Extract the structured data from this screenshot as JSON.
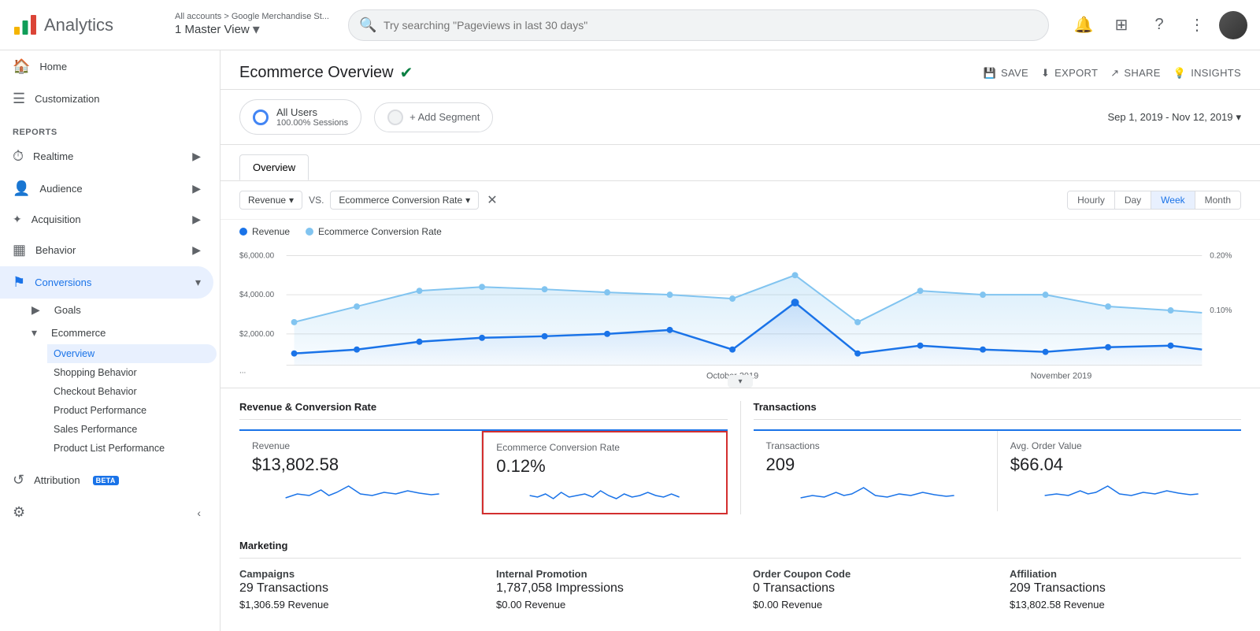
{
  "topNav": {
    "logoText": "Analytics",
    "breadcrumb": "All accounts > Google Merchandise St...",
    "viewLabel": "1 Master View",
    "searchPlaceholder": "Try searching \"Pageviews in last 30 days\"",
    "icons": [
      "bell",
      "grid",
      "help",
      "more-vert"
    ]
  },
  "sidebar": {
    "items": [
      {
        "id": "home",
        "label": "Home",
        "icon": "🏠",
        "level": 0
      },
      {
        "id": "customization",
        "label": "Customization",
        "icon": "☰",
        "level": 0
      },
      {
        "id": "reports-section",
        "label": "REPORTS",
        "type": "section"
      },
      {
        "id": "realtime",
        "label": "Realtime",
        "icon": "⏱",
        "level": 0,
        "expand": true
      },
      {
        "id": "audience",
        "label": "Audience",
        "icon": "👤",
        "level": 0,
        "expand": true
      },
      {
        "id": "acquisition",
        "label": "Acquisition",
        "icon": "✦",
        "level": 0,
        "expand": true
      },
      {
        "id": "behavior",
        "label": "Behavior",
        "icon": "▦",
        "level": 0,
        "expand": true
      },
      {
        "id": "conversions",
        "label": "Conversions",
        "icon": "⚑",
        "level": 0,
        "expand": true,
        "active": true
      },
      {
        "id": "goals",
        "label": "Goals",
        "level": 1,
        "expand": true
      },
      {
        "id": "ecommerce",
        "label": "Ecommerce",
        "level": 1,
        "expand": true
      },
      {
        "id": "overview",
        "label": "Overview",
        "level": 2,
        "active": true
      },
      {
        "id": "shopping-behavior",
        "label": "Shopping Behavior",
        "level": 2
      },
      {
        "id": "checkout-behavior",
        "label": "Checkout Behavior",
        "level": 2
      },
      {
        "id": "product-performance",
        "label": "Product Performance",
        "level": 2
      },
      {
        "id": "sales-performance",
        "label": "Sales Performance",
        "level": 2
      },
      {
        "id": "product-list-performance",
        "label": "Product List Performance",
        "level": 2
      },
      {
        "id": "attribution",
        "label": "Attribution",
        "icon": "↺",
        "level": 0,
        "badge": "BETA"
      }
    ]
  },
  "pageHeader": {
    "title": "Ecommerce Overview",
    "actions": [
      {
        "id": "save",
        "label": "SAVE",
        "icon": "💾"
      },
      {
        "id": "export",
        "label": "EXPORT",
        "icon": "⬇"
      },
      {
        "id": "share",
        "label": "SHARE",
        "icon": "↗"
      },
      {
        "id": "insights",
        "label": "INSIGHTS",
        "icon": "💡"
      }
    ]
  },
  "segment": {
    "allUsers": {
      "name": "All Users",
      "sub": "100.00% Sessions"
    },
    "addSegmentLabel": "+ Add Segment"
  },
  "dateRange": "Sep 1, 2019 - Nov 12, 2019",
  "tabs": [
    {
      "id": "overview",
      "label": "Overview",
      "active": true
    }
  ],
  "chartControls": {
    "metric1": "Revenue",
    "metric2": "Ecommerce Conversion Rate",
    "vsLabel": "VS.",
    "timeButtons": [
      {
        "id": "hourly",
        "label": "Hourly"
      },
      {
        "id": "day",
        "label": "Day"
      },
      {
        "id": "week",
        "label": "Week",
        "active": true
      },
      {
        "id": "month",
        "label": "Month"
      }
    ]
  },
  "chartLegend": {
    "items": [
      {
        "id": "revenue",
        "label": "Revenue",
        "color": "#1a73e8"
      },
      {
        "id": "ecr",
        "label": "Ecommerce Conversion Rate",
        "color": "#81c4f0"
      }
    ]
  },
  "chartYLabels": {
    "revenue": [
      "$6,000.00",
      "$4,000.00",
      "$2,000.00",
      "..."
    ],
    "ecr": [
      "0.20%",
      "0.10%"
    ]
  },
  "chartXLabels": [
    "October 2019",
    "November 2019"
  ],
  "metricsSection": {
    "title": "Revenue & Conversion Rate",
    "cards": [
      {
        "id": "revenue",
        "label": "Revenue",
        "value": "$13,802.58",
        "highlighted": false
      },
      {
        "id": "ecr",
        "label": "Ecommerce Conversion Rate",
        "value": "0.12%",
        "highlighted": true
      }
    ]
  },
  "transactionsSection": {
    "title": "Transactions",
    "cards": [
      {
        "id": "transactions",
        "label": "Transactions",
        "value": "209",
        "highlighted": false
      },
      {
        "id": "avg-order",
        "label": "Avg. Order Value",
        "value": "$66.04",
        "highlighted": false
      }
    ]
  },
  "marketingSection": {
    "title": "Marketing",
    "cards": [
      {
        "id": "campaigns",
        "name": "Campaigns",
        "sub": "29 Transactions",
        "revenue": "$1,306.59 Revenue"
      },
      {
        "id": "internal-promotion",
        "name": "Internal Promotion",
        "sub": "1,787,058 Impressions",
        "revenue": "$0.00 Revenue"
      },
      {
        "id": "order-coupon",
        "name": "Order Coupon Code",
        "sub": "0 Transactions",
        "revenue": "$0.00 Revenue"
      },
      {
        "id": "affiliation",
        "name": "Affiliation",
        "sub": "209 Transactions",
        "revenue": "$13,802.58 Revenue"
      }
    ]
  }
}
